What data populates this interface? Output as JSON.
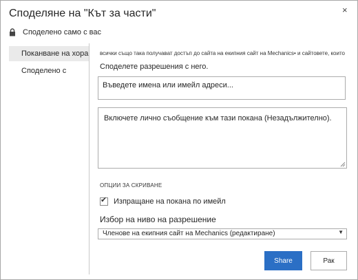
{
  "dialog": {
    "title": "Споделяне на \"Кът за части\"",
    "close_glyph": "×"
  },
  "sharing_status": {
    "icon": "lock-icon",
    "text": "Споделено само с вас"
  },
  "sidebar": {
    "items": [
      {
        "label": "Поканване на хора",
        "active": true
      },
      {
        "label": "Споделено с",
        "active": false
      }
    ]
  },
  "main": {
    "info_text": "всички също така получават достъп до сайта на екипния сайт на Mechanics• и сайтовете, които",
    "sub_info": "Споделете разрешения с него.",
    "names_input_placeholder": "Въведете имена или имейл адреси...",
    "message_placeholder": "Включете лично съобщение към тази покана (Незадължително).",
    "hide_options": "ОПЦИИ ЗА СКРИВАНЕ",
    "send_email_label": "Изпращане на покана по имейл",
    "send_email_checked": true,
    "permission_label": "Избор на ниво на разрешение",
    "permission_selected": "Членове на екипния сайт на Mechanics (редактиране)",
    "share_button": "Share",
    "cancel_button": "Рак"
  },
  "colors": {
    "accent": "#2b6fc5",
    "border": "#ababab",
    "sidebar_active": "#eaeaea"
  }
}
